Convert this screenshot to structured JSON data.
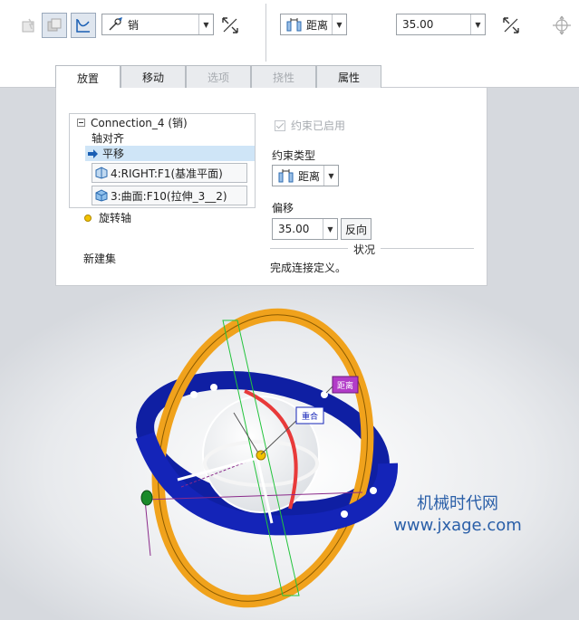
{
  "toolbar": {
    "connection_type": "销",
    "reference_type": "距离",
    "offset_value": "35.00",
    "icons": [
      "constraint-icon",
      "copy-icon",
      "curve-icon",
      "flip-icon",
      "flip-icon",
      "move-icon"
    ]
  },
  "tabs": [
    {
      "label": "放置",
      "state": "active"
    },
    {
      "label": "移动",
      "state": "normal"
    },
    {
      "label": "选项",
      "state": "disabled"
    },
    {
      "label": "挠性",
      "state": "disabled"
    },
    {
      "label": "属性",
      "state": "normal"
    }
  ],
  "placement": {
    "tree": {
      "connection": "Connection_4 (销)",
      "axis_align": "轴对齐",
      "translate": "平移",
      "ref1": "4:RIGHT:F1(基准平面)",
      "ref2": "3:曲面:F10(拉伸_3__2)",
      "rotation_axis": "旋转轴",
      "new_set": "新建集"
    },
    "constraint_enabled_label": "约束已启用",
    "constraint_type_label": "约束类型",
    "constraint_type_value": "距离",
    "offset_label": "偏移",
    "offset_value": "35.00",
    "flip_button": "反向",
    "status_label": "状况",
    "status_text": "完成连接定义。"
  },
  "viewport": {
    "tag_distance": "距离",
    "tag_coincident": "重合"
  },
  "watermark": {
    "line1": "机械时代网",
    "line2": "www.jxage.com"
  },
  "colors": {
    "ring_orange": "#f0a21c",
    "ring_blue": "#1424b8",
    "selection": "#cfe5f7",
    "watermark": "#2a5fa8"
  }
}
